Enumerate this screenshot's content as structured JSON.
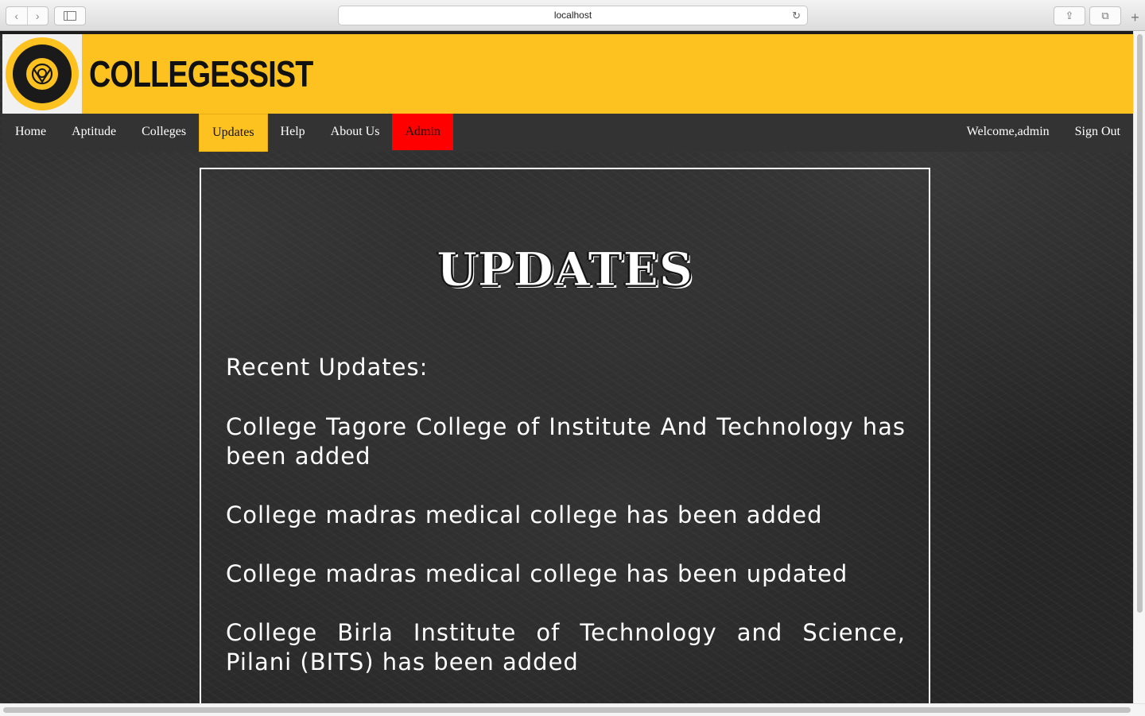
{
  "browser": {
    "url": "localhost",
    "back_glyph": "‹",
    "forward_glyph": "›",
    "reload_glyph": "↻",
    "share_glyph": "⇪",
    "tabs_glyph": "⧉",
    "newtab_glyph": "+"
  },
  "site": {
    "brand": "COLLEGESSIST",
    "logo_symbol": "ᘐ",
    "accent_color": "#fec220",
    "admin_color": "#ff0000",
    "nav_bg": "#333333"
  },
  "nav": {
    "left": [
      "Home",
      "Aptitude",
      "Colleges",
      "Updates",
      "Help",
      "About Us",
      "Admin"
    ],
    "active": "Updates",
    "welcome": "Welcome,admin",
    "signout": "Sign Out"
  },
  "content": {
    "title": "UPDATES",
    "recent_label": "Recent Updates:",
    "updates": [
      "College Tagore College of Institute And Technology has been added",
      "College madras medical college has been added",
      "College madras medical college has been updated",
      "College Birla Institute of Technology and Science, Pilani (BITS) has been added"
    ]
  }
}
